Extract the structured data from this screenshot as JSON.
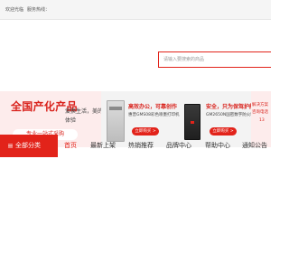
{
  "topbar": {
    "welcome": "欢迎光临",
    "service": "服务热线："
  },
  "search": {
    "placeholder": "请输入要搜索的商品"
  },
  "banner": {
    "title": "全国产化产品",
    "subtitle": "专业一站式采购",
    "slogan": "爱换生活，美的体验",
    "promos": [
      {
        "title": "高效办公，可靠创作",
        "desc": "惠普GMS08彩色喷墨打印机",
        "button": "立即购买 >"
      },
      {
        "title": "安全，只为保驾护航",
        "desc": "GM2650N国密数字防火墙",
        "button": "立即购买 >"
      }
    ],
    "side": {
      "line1": "解决方案",
      "line2": "咨询电话",
      "tel": "13"
    }
  },
  "nav": {
    "all_categories": "全部分类",
    "items": [
      "首页",
      "最新上架",
      "热销推荐",
      "品牌中心",
      "帮助中心",
      "通知公告"
    ],
    "active_index": 0
  },
  "colors": {
    "accent": "#e2231a",
    "banner_bg": "#fdecec"
  }
}
